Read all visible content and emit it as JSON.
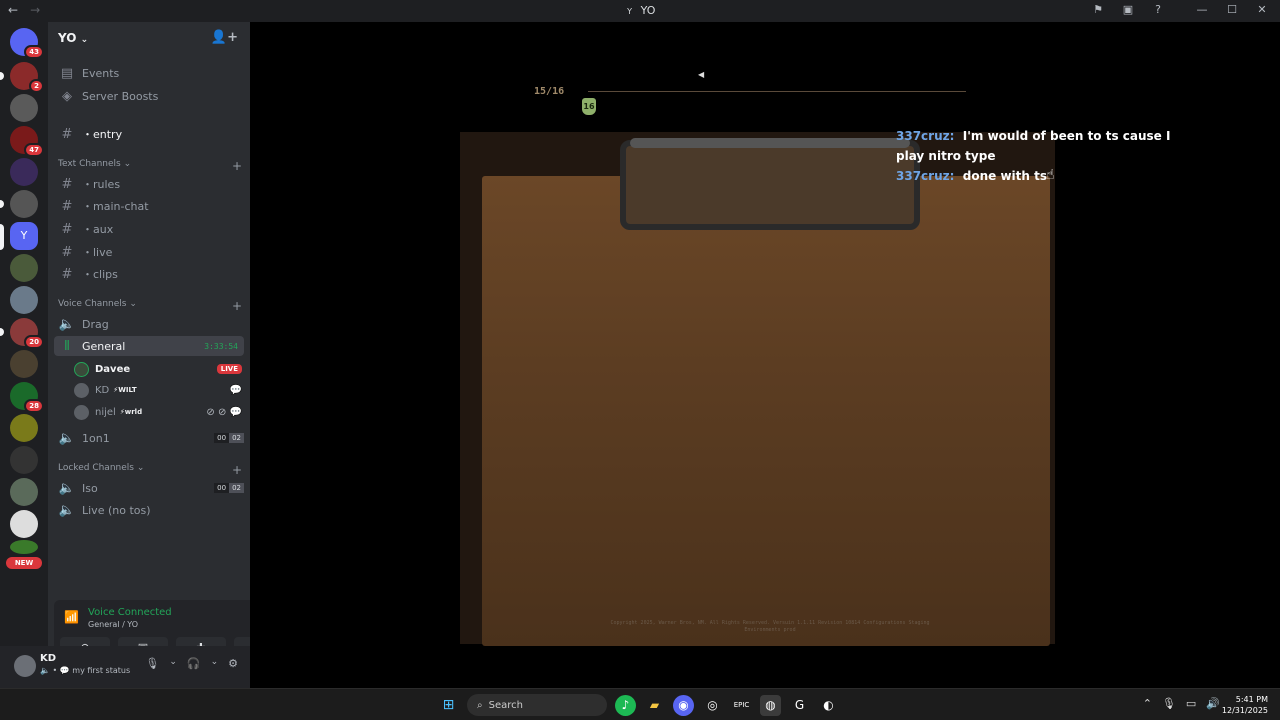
{
  "window": {
    "title": "YO",
    "controls": [
      "flag-icon",
      "inbox-icon",
      "help-icon",
      "minimize",
      "maximize",
      "close"
    ]
  },
  "servers": {
    "badges": [
      "43",
      "2",
      "47",
      "20",
      "28"
    ],
    "new_label": "NEW"
  },
  "guild": {
    "name": "YO"
  },
  "sidebar": {
    "top_items": [
      {
        "label": "Events",
        "icon": "calendar-icon"
      },
      {
        "label": "Server Boosts",
        "icon": "boost-icon"
      }
    ],
    "entry": {
      "label": "・entry"
    },
    "text_category": "Text Channels",
    "text_channels": [
      "・rules",
      "・main-chat",
      "・aux",
      "・live",
      "・clips"
    ],
    "voice_category": "Voice Channels",
    "voice_drag": "Drag",
    "voice_general": {
      "label": "General",
      "timer": "3:33:54"
    },
    "general_users": [
      {
        "name": "Davee",
        "live": "LIVE"
      },
      {
        "name": "KD",
        "tag": "WILT"
      },
      {
        "name": "nijel",
        "tag": "wrld"
      }
    ],
    "voice_1on1": {
      "label": "1on1",
      "counts": [
        "00",
        "02"
      ]
    },
    "locked_category": "Locked Channels",
    "locked_iso": {
      "label": "Iso",
      "counts": [
        "00",
        "02"
      ]
    },
    "locked_live": "Live (no tos)"
  },
  "voice_panel": {
    "title": "Voice Connected",
    "subtitle": "General / YO"
  },
  "user_panel": {
    "name": "KD",
    "status": "my first status"
  },
  "stream": {
    "counter_current": "15",
    "counter_total": "/16",
    "marker": "16",
    "chat": [
      {
        "name": "337cruz:",
        "text": "I'm would of been to ts cause I play nitro type"
      },
      {
        "name": "337cruz:",
        "text": "done with ts"
      }
    ],
    "copyright": "Copyright 2025, Warner Bros, NM. All Rights Reserved. Versuin 1.1.11 Revision 10814 Configurations Staging Environments prod"
  },
  "taskbar": {
    "search": "Search",
    "time": "5:41 PM",
    "date": "12/31/2025"
  },
  "colors": {
    "accent_green": "#23a559",
    "badge_red": "#da373c",
    "chat_name": "#6fa5e6"
  }
}
